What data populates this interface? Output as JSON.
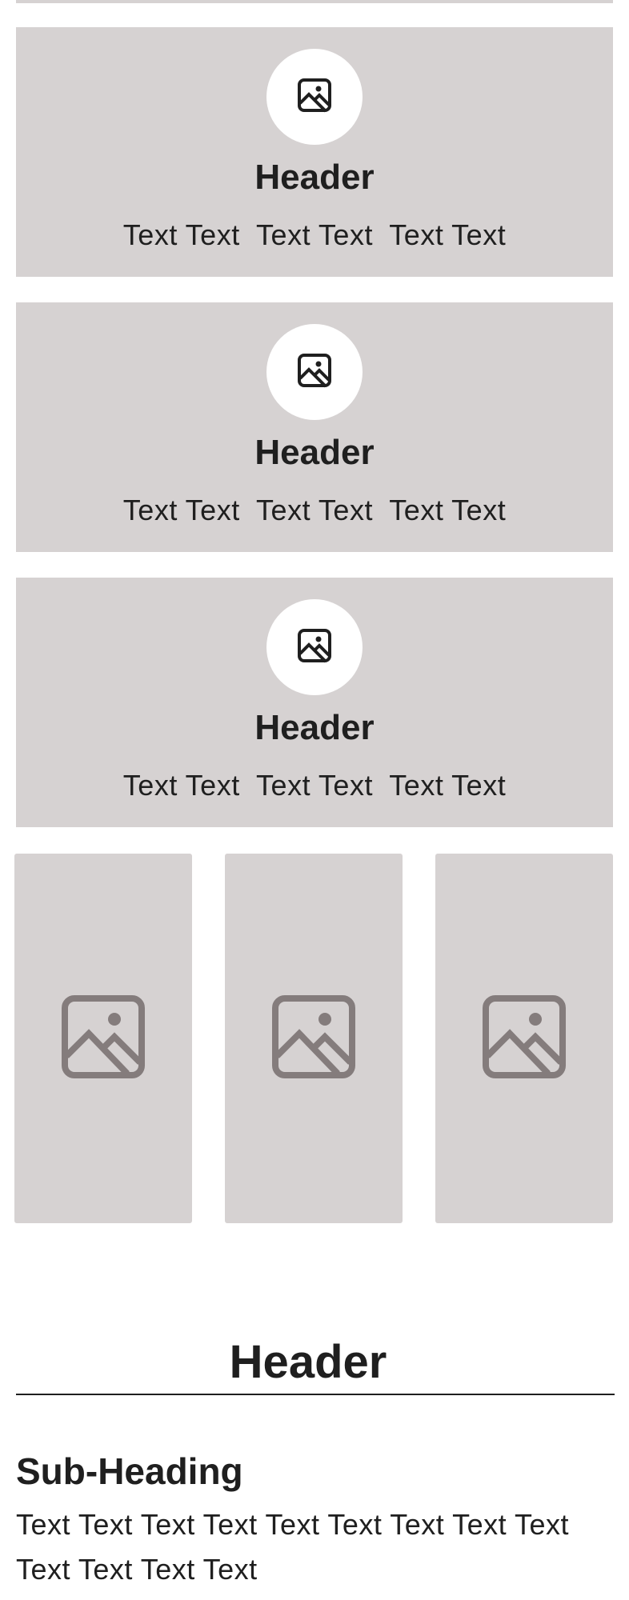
{
  "feature_cards": [
    {
      "icon": "image-icon",
      "title": "Header",
      "text": "Text Text  Text Text  Text Text"
    },
    {
      "icon": "image-icon",
      "title": "Header",
      "text": "Text Text  Text Text  Text Text"
    },
    {
      "icon": "image-icon",
      "title": "Header",
      "text": "Text Text  Text Text  Text Text"
    }
  ],
  "image_tiles": [
    {
      "icon": "image-placeholder-icon"
    },
    {
      "icon": "image-placeholder-icon"
    },
    {
      "icon": "image-placeholder-icon"
    }
  ],
  "section": {
    "title": "Header",
    "sub_heading": "Sub-Heading",
    "body": "Text Text Text Text Text Text Text Text Text Text Text Text Text"
  },
  "colors": {
    "card_background": "#d6d2d2",
    "text": "#1f1f1f",
    "placeholder_icon": "#847c7c",
    "icon_circle": "#ffffff"
  }
}
